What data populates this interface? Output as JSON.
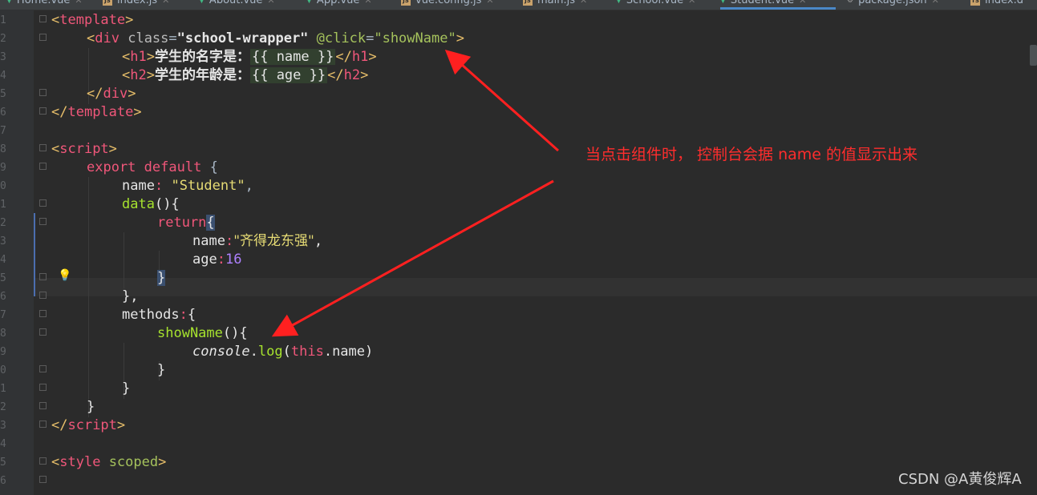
{
  "tabs": [
    {
      "label": "Home.vue",
      "icon": "vue-icon"
    },
    {
      "label": "index.js",
      "icon": "js-icon"
    },
    {
      "label": "About.vue",
      "icon": "vue-icon"
    },
    {
      "label": "App.vue",
      "icon": "vue-icon"
    },
    {
      "label": "vue.config.js",
      "icon": "js-icon"
    },
    {
      "label": "main.js",
      "icon": "js-icon"
    },
    {
      "label": "School.vue",
      "icon": "vue-icon"
    },
    {
      "label": "Student.vue",
      "icon": "vue-icon",
      "active": true
    },
    {
      "label": "package.json",
      "icon": "json-icon"
    },
    {
      "label": "index.d",
      "icon": "js-icon"
    }
  ],
  "line_numbers": [
    "1",
    "2",
    "3",
    "4",
    "5",
    "6",
    "7",
    "8",
    "9",
    "0",
    "1",
    "2",
    "3",
    "4",
    "5",
    "6",
    "7",
    "8",
    "9",
    "0",
    "1",
    "2",
    "3",
    "4",
    "5",
    "6"
  ],
  "code": {
    "l1": {
      "open": "<",
      "name": "template",
      "close": ">"
    },
    "l2": {
      "open": "<",
      "name": "div",
      "attr1": "class",
      "eq": "=",
      "val1": "\"school-wrapper\"",
      "attr2": "@click",
      "val2": "\"showName\"",
      "close": ">"
    },
    "l3": {
      "open": "<",
      "name": "h1",
      "close": ">",
      "text": "学生的名字是：",
      "mustache": "{{ name }}",
      "endopen": "</",
      "endname": "h1",
      "endclose": ">"
    },
    "l4": {
      "open": "<",
      "name": "h2",
      "close": ">",
      "text": "学生的年龄是：",
      "mustache": "{{ age }}",
      "endopen": "</",
      "endname": "h2",
      "endclose": ">"
    },
    "l5": {
      "endopen": "</",
      "name": "div",
      "close": ">"
    },
    "l6": {
      "endopen": "</",
      "name": "template",
      "close": ">"
    },
    "l8": {
      "open": "<",
      "name": "script",
      "close": ">"
    },
    "l9": {
      "kw1": "export",
      "kw2": "default",
      "brace": "{"
    },
    "l10": {
      "key": "name",
      "colon": ":",
      "value": "\"Student\"",
      "comma": ","
    },
    "l11": {
      "fn": "data",
      "rest": "(){"
    },
    "l12": {
      "kw": "return",
      "brace": "{"
    },
    "l13": {
      "key": "name",
      "colon": ":",
      "value": "\"齐得龙东强\"",
      "comma": ","
    },
    "l14": {
      "key": "age",
      "colon": ":",
      "value": "16"
    },
    "l15": {
      "brace": "}"
    },
    "l16": {
      "text": "},"
    },
    "l17": {
      "key": "methods",
      "colon": ":",
      "brace": "{"
    },
    "l18": {
      "fn": "showName",
      "rest": "(){"
    },
    "l19": {
      "obj": "console",
      "dot": ".",
      "fn": "log",
      "paren1": "(",
      "kw": "this",
      "prop": ".name",
      "paren2": ")"
    },
    "l20": {
      "text": "}"
    },
    "l21": {
      "text": "}"
    },
    "l22": {
      "text": "}"
    },
    "l23": {
      "endopen": "</",
      "name": "script",
      "close": ">"
    },
    "l25": {
      "open": "<",
      "name": "style",
      "attr": "scoped",
      "close": ">"
    }
  },
  "annotation": {
    "text": "当点击组件时， 控制台会据 name 的值显示出来",
    "color": "#ff2d2d"
  },
  "watermark": "CSDN @A黄俊辉A"
}
